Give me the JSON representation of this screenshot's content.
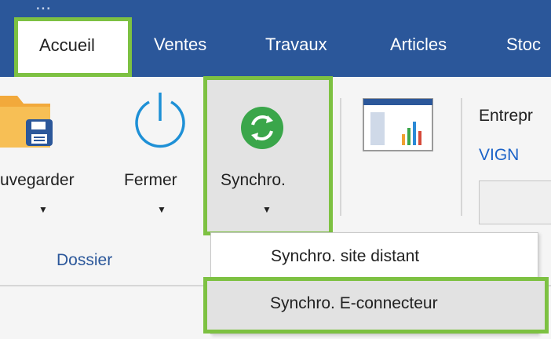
{
  "window": {
    "title": "..."
  },
  "menu": {
    "tabs": [
      {
        "label": "Accueil",
        "active": true
      },
      {
        "label": "Ventes"
      },
      {
        "label": "Travaux"
      },
      {
        "label": "Articles"
      },
      {
        "label": "Stoc"
      }
    ]
  },
  "ribbon": {
    "buttons": {
      "save": {
        "label": "uvegarder",
        "icon": "save-folder-icon"
      },
      "close": {
        "label": "Fermer",
        "icon": "power-icon"
      },
      "sync": {
        "label": "Synchro.",
        "icon": "sync-icon"
      },
      "report": {
        "icon": "report-chart-icon"
      }
    },
    "group_label": "Dossier",
    "company": {
      "label": "Entrepr",
      "value": "VIGN"
    }
  },
  "dropdown": {
    "items": [
      {
        "label": "Synchro. site distant"
      },
      {
        "label": "Synchro. E-connecteur",
        "hover": true
      }
    ]
  },
  "colors": {
    "accent_blue": "#2b579a",
    "highlight_green": "#7dc142",
    "sync_green": "#3aa64a",
    "power_blue": "#1e90d6",
    "link_blue": "#1a62c8"
  }
}
